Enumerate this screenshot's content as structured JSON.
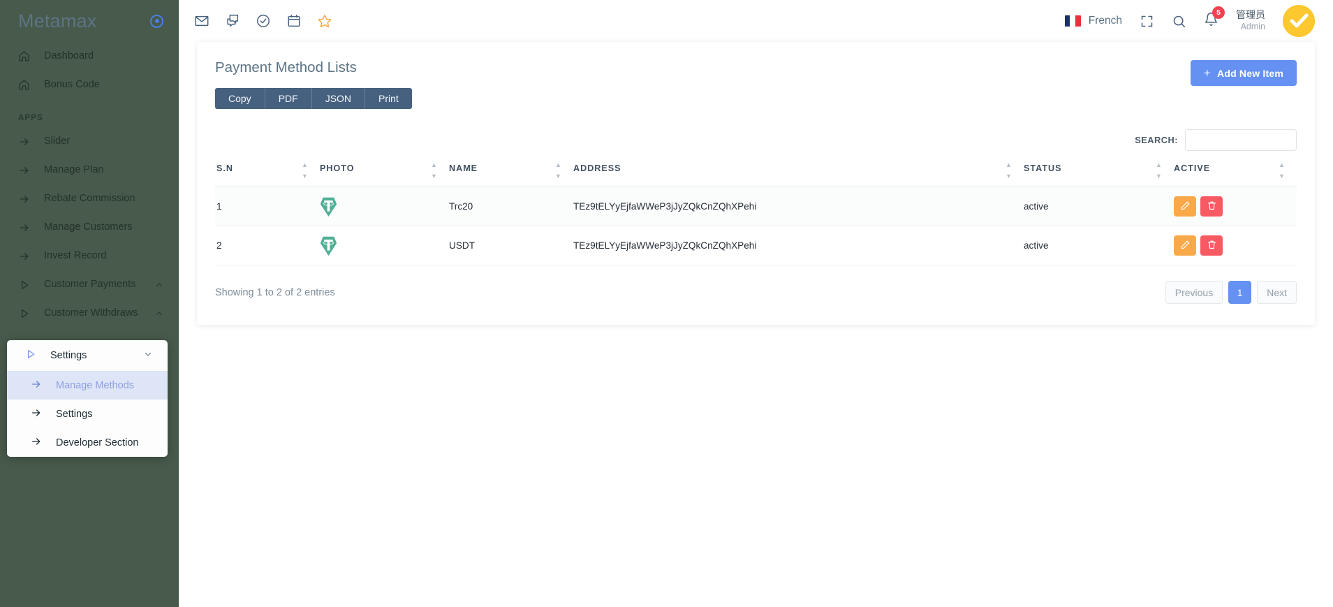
{
  "sidebar": {
    "brand": "Metamax",
    "brand_dot_color": "#4a7ee0",
    "background": "#475a4b",
    "top_items": [
      {
        "label": "Dashboard",
        "icon": "home-icon"
      },
      {
        "label": "Bonus Code",
        "icon": "home-icon"
      }
    ],
    "section_label": "APPS",
    "app_items": [
      {
        "label": "Slider",
        "icon": "arrow-right-icon",
        "expandable": false
      },
      {
        "label": "Manage Plan",
        "icon": "arrow-right-icon",
        "expandable": false
      },
      {
        "label": "Rebate Commission",
        "icon": "arrow-right-icon",
        "expandable": false
      },
      {
        "label": "Manage Customers",
        "icon": "arrow-right-icon",
        "expandable": false
      },
      {
        "label": "Invest Record",
        "icon": "arrow-right-icon",
        "expandable": false
      },
      {
        "label": "Customer Payments",
        "icon": "play-triangle-icon",
        "expandable": true,
        "caret": "chevron-up-icon"
      },
      {
        "label": "Customer Withdraws",
        "icon": "play-triangle-icon",
        "expandable": true,
        "caret": "chevron-up-icon"
      }
    ],
    "submenu": {
      "header": {
        "label": "Settings",
        "icon": "play-triangle-icon",
        "caret": "chevron-down-icon"
      },
      "items": [
        {
          "label": "Manage Methods",
          "icon": "arrow-right-icon",
          "active": true
        },
        {
          "label": "Settings",
          "icon": "arrow-right-icon",
          "active": false
        },
        {
          "label": "Developer Section",
          "icon": "arrow-right-icon",
          "active": false
        }
      ],
      "active_bg": "#dee5f7",
      "active_color": "#8d9fe0"
    }
  },
  "topbar": {
    "left_icons": [
      {
        "name": "mail-icon"
      },
      {
        "name": "chat-icon"
      },
      {
        "name": "check-circle-icon"
      },
      {
        "name": "calendar-icon"
      },
      {
        "name": "star-icon"
      }
    ],
    "language": "French",
    "language_flag": "france-flag-icon",
    "fullscreen_icon": "fullscreen-icon",
    "search_icon": "search-icon",
    "notification_icon": "bell-icon",
    "notification_count": "5",
    "notification_badge_color": "#f0434f",
    "user_name": "管理员",
    "user_role": "Admin",
    "avatar_icon": "check-avatar",
    "avatar_color": "#fdc82f"
  },
  "page": {
    "title": "Payment Method Lists",
    "add_button": "Add New Item",
    "add_button_color": "#6591f2",
    "export_buttons": [
      "Copy",
      "PDF",
      "JSON",
      "Print"
    ],
    "export_color": "#46607f",
    "search_label": "SEARCH:",
    "search_value": "",
    "search_placeholder": ""
  },
  "table": {
    "columns": [
      "S.N",
      "PHOTO",
      "NAME",
      "ADDRESS",
      "STATUS",
      "ACTIVE"
    ],
    "rows": [
      {
        "sn": "1",
        "photo": "usdt-tether-logo",
        "name": "Trc20",
        "address": "TEz9tELYyEjfaWWeP3jJyZQkCnZQhXPehi",
        "status": "active",
        "actions": [
          "edit-icon",
          "delete-icon"
        ]
      },
      {
        "sn": "2",
        "photo": "usdt-tether-logo",
        "name": "USDT",
        "address": "TEz9tELYyEjfaWWeP3jJyZQkCnZQhXPehi",
        "status": "active",
        "actions": [
          "edit-icon",
          "delete-icon"
        ]
      }
    ],
    "entries_info": "Showing 1 to 2 of 2 entries",
    "pagination": {
      "previous": "Previous",
      "pages": [
        "1"
      ],
      "next": "Next",
      "current": "1",
      "active_color": "#6591f2"
    },
    "edit_color": "#f9a94a",
    "delete_color": "#f75a62",
    "coin_color": "#50af95"
  }
}
